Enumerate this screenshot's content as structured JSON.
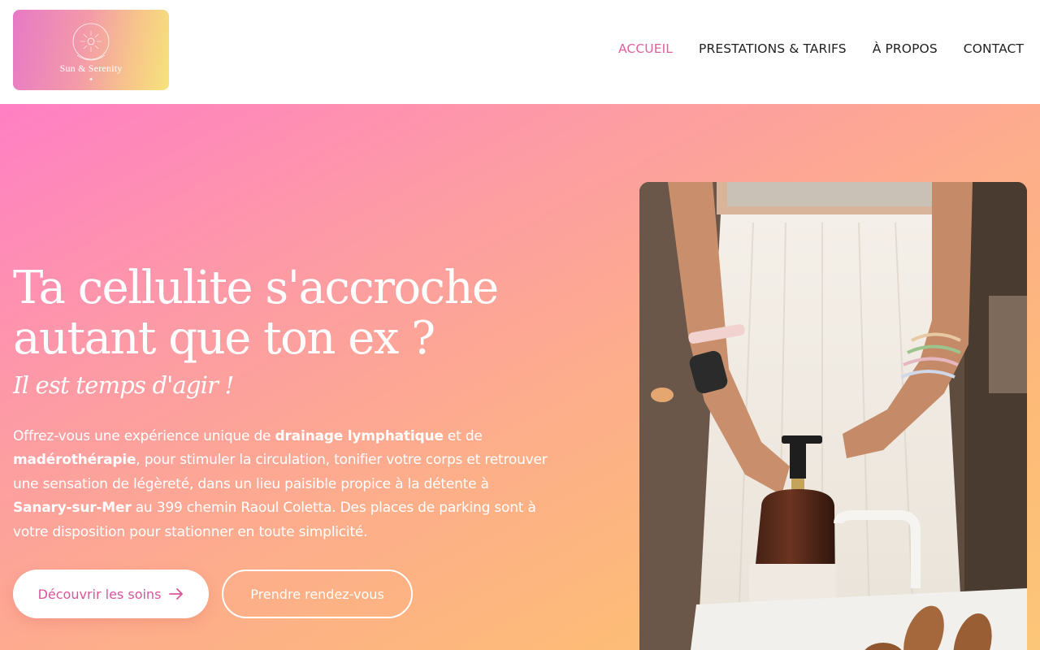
{
  "header": {
    "logo": {
      "text": "Sun & Serenity",
      "sparkle": "✦",
      "colors": [
        "#e879c6",
        "#f39aa8",
        "#f7c58a",
        "#f6e37a"
      ]
    },
    "nav": [
      {
        "label": "ACCUEIL",
        "active": true
      },
      {
        "label": "PRESTATIONS & TARIFS",
        "active": false
      },
      {
        "label": "À PROPOS",
        "active": false
      },
      {
        "label": "CONTACT",
        "active": false
      }
    ],
    "accent_color": "#e0609c"
  },
  "hero": {
    "title_line1": "Ta cellulite s'accroche",
    "title_line2": "autant que ton ex ?",
    "subtitle": "Il est temps d'agir !",
    "text": {
      "p1": "Offrez-vous une expérience unique de ",
      "b1": "drainage lymphatique",
      "p2": " et de ",
      "b2": "madérothérapie",
      "p3": ", pour stimuler la circulation, tonifier votre corps et retrouver une sensation de légèreté, dans un lieu paisible propice à la détente à ",
      "b3": "Sanary-sur-Mer",
      "p4": " au 399 chemin Raoul Coletta. Des places de parking sont à votre disposition pour stationner en toute simplicité."
    },
    "primary_button": "Découvrir les soins",
    "primary_button_icon": "arrow-right-icon",
    "secondary_button": "Prendre rendez-vous"
  }
}
